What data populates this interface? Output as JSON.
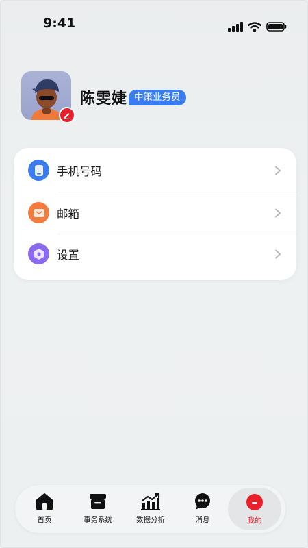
{
  "status_bar": {
    "time": "9:41"
  },
  "profile": {
    "name": "陈雯婕",
    "role": "中策业务员"
  },
  "menu": {
    "items": [
      {
        "label": "手机号码",
        "icon": "phone-icon",
        "color": "#3b7df0"
      },
      {
        "label": "邮箱",
        "icon": "mail-icon",
        "color": "#f57b3d"
      },
      {
        "label": "设置",
        "icon": "settings-icon",
        "color": "#8a6bf0"
      }
    ]
  },
  "tab_bar": {
    "tabs": [
      {
        "label": "首页",
        "icon": "home-icon"
      },
      {
        "label": "事务系统",
        "icon": "archive-icon"
      },
      {
        "label": "数据分析",
        "icon": "chart-icon"
      },
      {
        "label": "消息",
        "icon": "message-icon"
      },
      {
        "label": "我的",
        "icon": "profile-icon",
        "active": true
      }
    ]
  },
  "colors": {
    "accent": "#e8202a",
    "badge": "#3b7df0",
    "background": "#edf0f1"
  }
}
